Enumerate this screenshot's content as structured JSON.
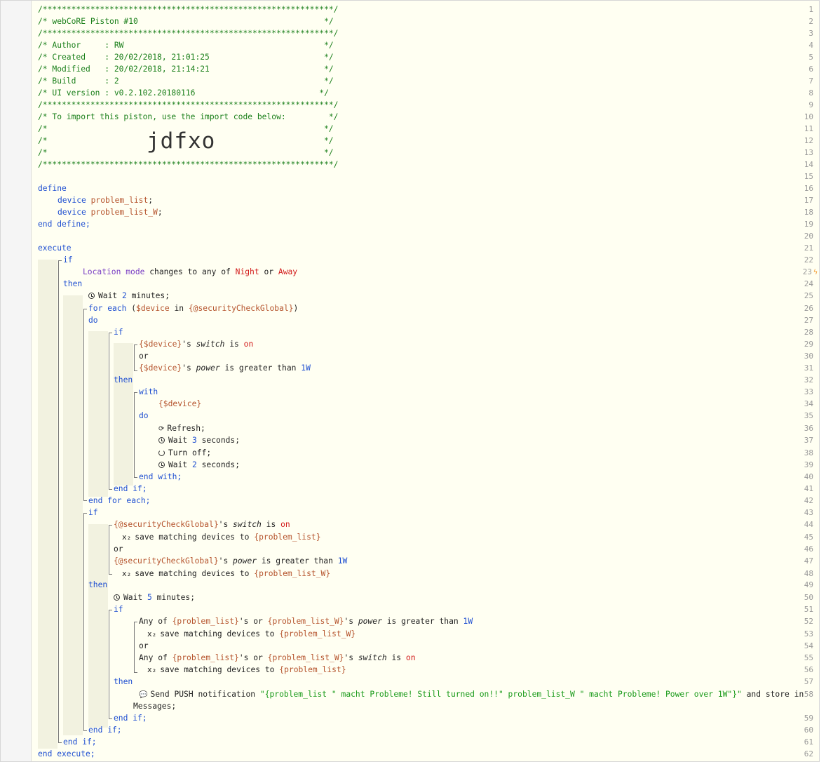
{
  "header": {
    "border_line": "/*************************************************************/",
    "piston_title": "/* webCoRE Piston #10                                       */",
    "author": "/* Author     : RW                                          */",
    "created": "/* Created    : 20/02/2018, 21:01:25                        */",
    "modified": "/* Modified   : 20/02/2018, 21:14:21                        */",
    "build": "/* Build      : 2                                           */",
    "ui_version": "/* UI version : v0.2.102.20180116                          */",
    "import_hint": "/* To import this piston, use the import code below:         */",
    "blank_prefix": "/*",
    "blank_suffix": "*/",
    "import_code": "jdfxo"
  },
  "code": {
    "define": "define",
    "device": "device",
    "problem_list": "problem_list",
    "problem_list_w": "problem_list_W",
    "semicolon": ";",
    "end_define": "end define;",
    "execute": "execute",
    "if": "if",
    "then": "then",
    "do": "do",
    "or": "or",
    "with": "with",
    "end_if": "end if;",
    "end_with": "end with;",
    "end_for_each": "end for each;",
    "end_execute": "end execute;",
    "location_mode": "Location mode",
    "changes_to_any_of": " changes to any of ",
    "night": "Night",
    "away": "Away",
    "wait": "Wait ",
    "minutes": " minutes;",
    "seconds": " seconds;",
    "two": "2",
    "three": "3",
    "five": "5",
    "for_each": "for each",
    "open_paren": " (",
    "device_var": "$device",
    "in_kw": " in ",
    "security_global": "{@securityCheckGlobal}",
    "close_paren": ")",
    "device_expr": "{$device}",
    "apostrophe_s": "'s ",
    "switch_attr": "switch",
    "is": " is ",
    "on": "on",
    "power_attr": "power",
    "is_greater_than": " is greater than ",
    "one_w": "1W",
    "refresh": "Refresh;",
    "turn_off": "Turn off;",
    "save_matching": "save matching devices to ",
    "pl_expr": "{problem_list}",
    "plw_expr": "{problem_list_W}",
    "any_of": "Any of ",
    "s_or": "'s or ",
    "send_push": "Send PUSH notification ",
    "push_message": "\"{problem_list \" macht Probleme! Still turned on!!\" problem_list_W \" macht Probleme! Power over 1W\"}\"",
    "and_store_in": " and store in",
    "messages": "Messages;"
  },
  "line_numbers": [
    "1",
    "2",
    "3",
    "4",
    "5",
    "6",
    "7",
    "8",
    "9",
    "10",
    "11",
    "12",
    "13",
    "14",
    "15",
    "16",
    "17",
    "18",
    "19",
    "20",
    "21",
    "22",
    "23",
    "24",
    "25",
    "26",
    "27",
    "28",
    "29",
    "30",
    "31",
    "32",
    "33",
    "34",
    "35",
    "36",
    "37",
    "38",
    "39",
    "40",
    "41",
    "42",
    "43",
    "44",
    "45",
    "46",
    "47",
    "48",
    "49",
    "50",
    "51",
    "52",
    "53",
    "54",
    "55",
    "56",
    "57",
    "58",
    "59",
    "60",
    "61",
    "62"
  ],
  "icons": {
    "trigger": "lightning-bolt-icon",
    "wait": "clock-icon",
    "refresh": "refresh-icon",
    "turn_off": "power-icon",
    "save": "subscript-x-icon",
    "push": "speech-bubble-icon"
  },
  "colors": {
    "background": "#fffff2",
    "keyword": "#1f4fd1",
    "comment": "#1a7f1a",
    "variable": "#b5532c",
    "value": "#d21a1a",
    "location": "#7a3fc4",
    "string": "#189a18",
    "trigger_bolt": "#f39c33"
  }
}
